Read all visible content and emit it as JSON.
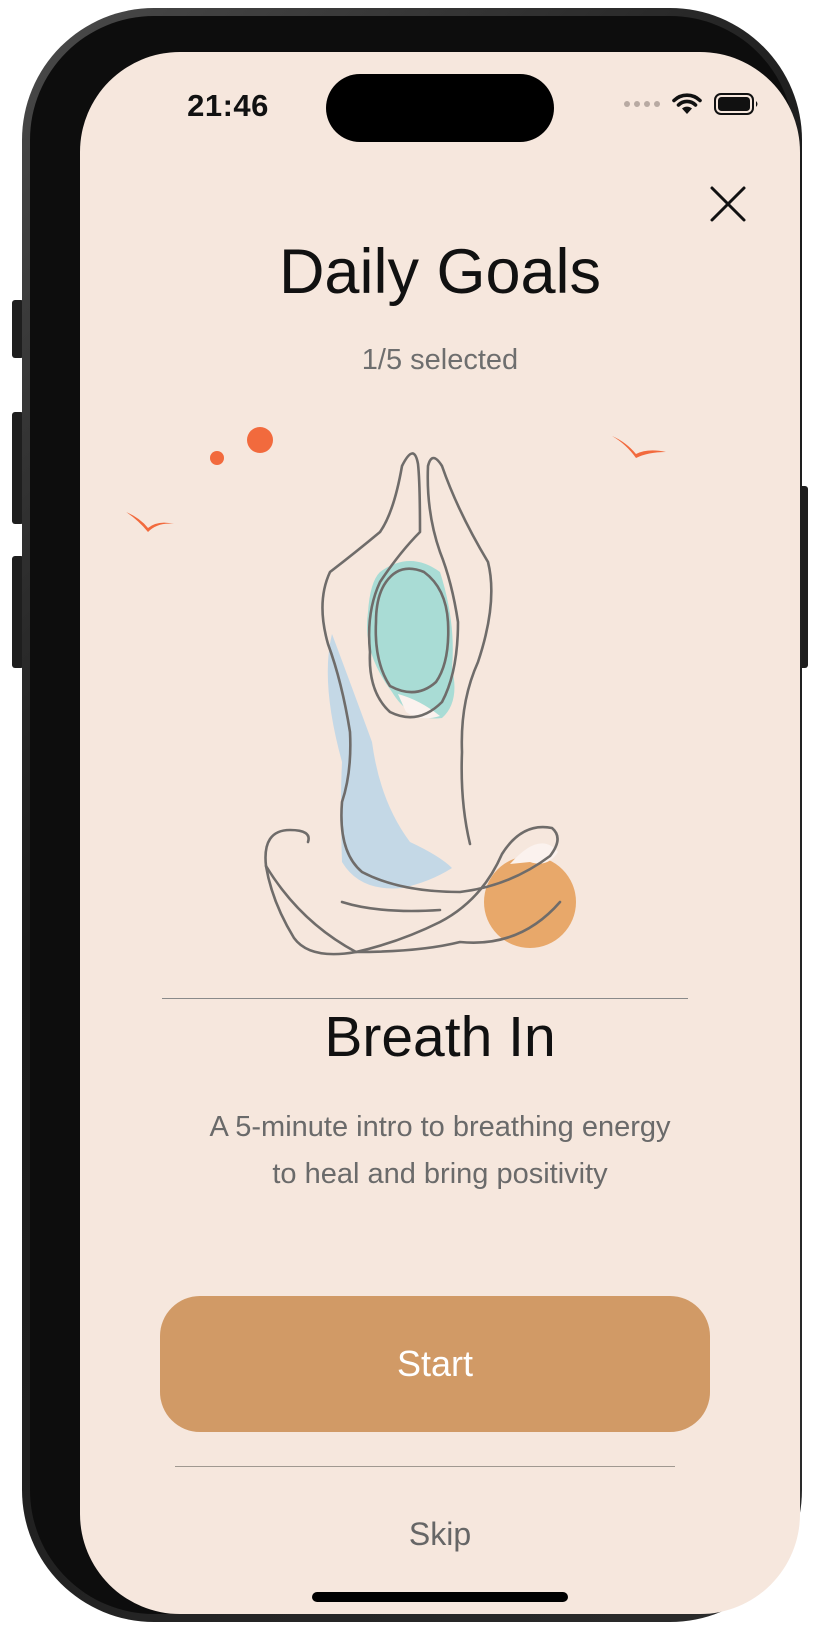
{
  "status_bar": {
    "time": "21:46",
    "icons": [
      "cellular-dots-icon",
      "wifi-icon",
      "battery-icon"
    ]
  },
  "header": {
    "close_icon": "close-icon",
    "title": "Daily Goals",
    "selection_status": "1/5 selected"
  },
  "illustration": {
    "name": "meditation-figure-illustration",
    "colors": {
      "line": "#6f6c6a",
      "birds": "#f26a3d",
      "head_blob": "#a9dcd5",
      "body_blob": "#c4d8e6",
      "knee_blob": "#e8a86a"
    }
  },
  "session": {
    "title": "Breath In",
    "description_line1": "A 5-minute intro to breathing energy",
    "description_line2": "to heal and bring positivity"
  },
  "actions": {
    "start_label": "Start",
    "skip_label": "Skip"
  },
  "theme": {
    "background": "#f6e7dd",
    "accent": "#d19a66",
    "text_primary": "#111111",
    "text_secondary": "#6e6e6e"
  }
}
